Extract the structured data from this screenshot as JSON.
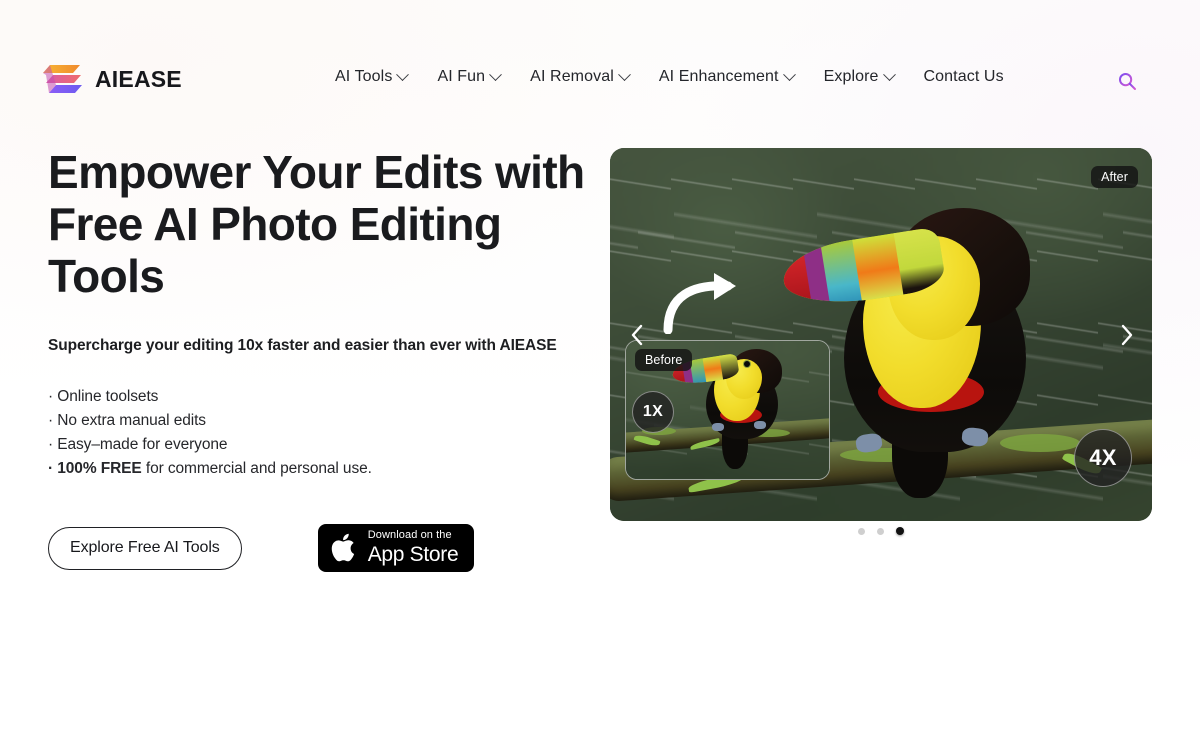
{
  "brand": {
    "name": "AIEASE",
    "logo_icon": "aiease-logo-icon",
    "colors": {
      "band_top": "#f5a623",
      "band_mid": "#e8617d",
      "band_bottom": "#7b5cf0"
    }
  },
  "nav": {
    "items": [
      {
        "label": "AI Tools",
        "has_dropdown": true
      },
      {
        "label": "AI Fun",
        "has_dropdown": true
      },
      {
        "label": "AI Removal",
        "has_dropdown": true
      },
      {
        "label": "AI Enhancement",
        "has_dropdown": true
      },
      {
        "label": "Explore",
        "has_dropdown": true
      },
      {
        "label": "Contact Us",
        "has_dropdown": false
      }
    ],
    "search_icon": "search-icon",
    "search_color": "#8b5cf6"
  },
  "hero": {
    "title": "Empower Your Edits with Free AI Photo Editing Tools",
    "subtitle": "Supercharge your editing 10x faster and easier than ever with AIEASE",
    "bullets": [
      {
        "text": "· Online toolsets",
        "bold_prefix": ""
      },
      {
        "text": "· No extra manual edits",
        "bold_prefix": ""
      },
      {
        "text": "· Easy–made for everyone",
        "bold_prefix": ""
      },
      {
        "text": " for commercial and personal use.",
        "bold_prefix": "· 100% FREE"
      }
    ],
    "primary_cta": "Explore Free AI Tools",
    "appstore": {
      "small_text": "Download on the",
      "big_text": "App Store",
      "icon": "apple-logo-icon"
    }
  },
  "carousel": {
    "after_label": "After",
    "before_label": "Before",
    "zoom_before": "1X",
    "zoom_after": "4X",
    "prev_icon": "chevron-left-icon",
    "next_icon": "chevron-right-icon",
    "arrow_hint_icon": "curved-arrow-icon",
    "dots": [
      {
        "active": false
      },
      {
        "active": false
      },
      {
        "active": true
      }
    ],
    "active_index": 3,
    "total_slides": 3,
    "subject": "toucan-photo"
  }
}
